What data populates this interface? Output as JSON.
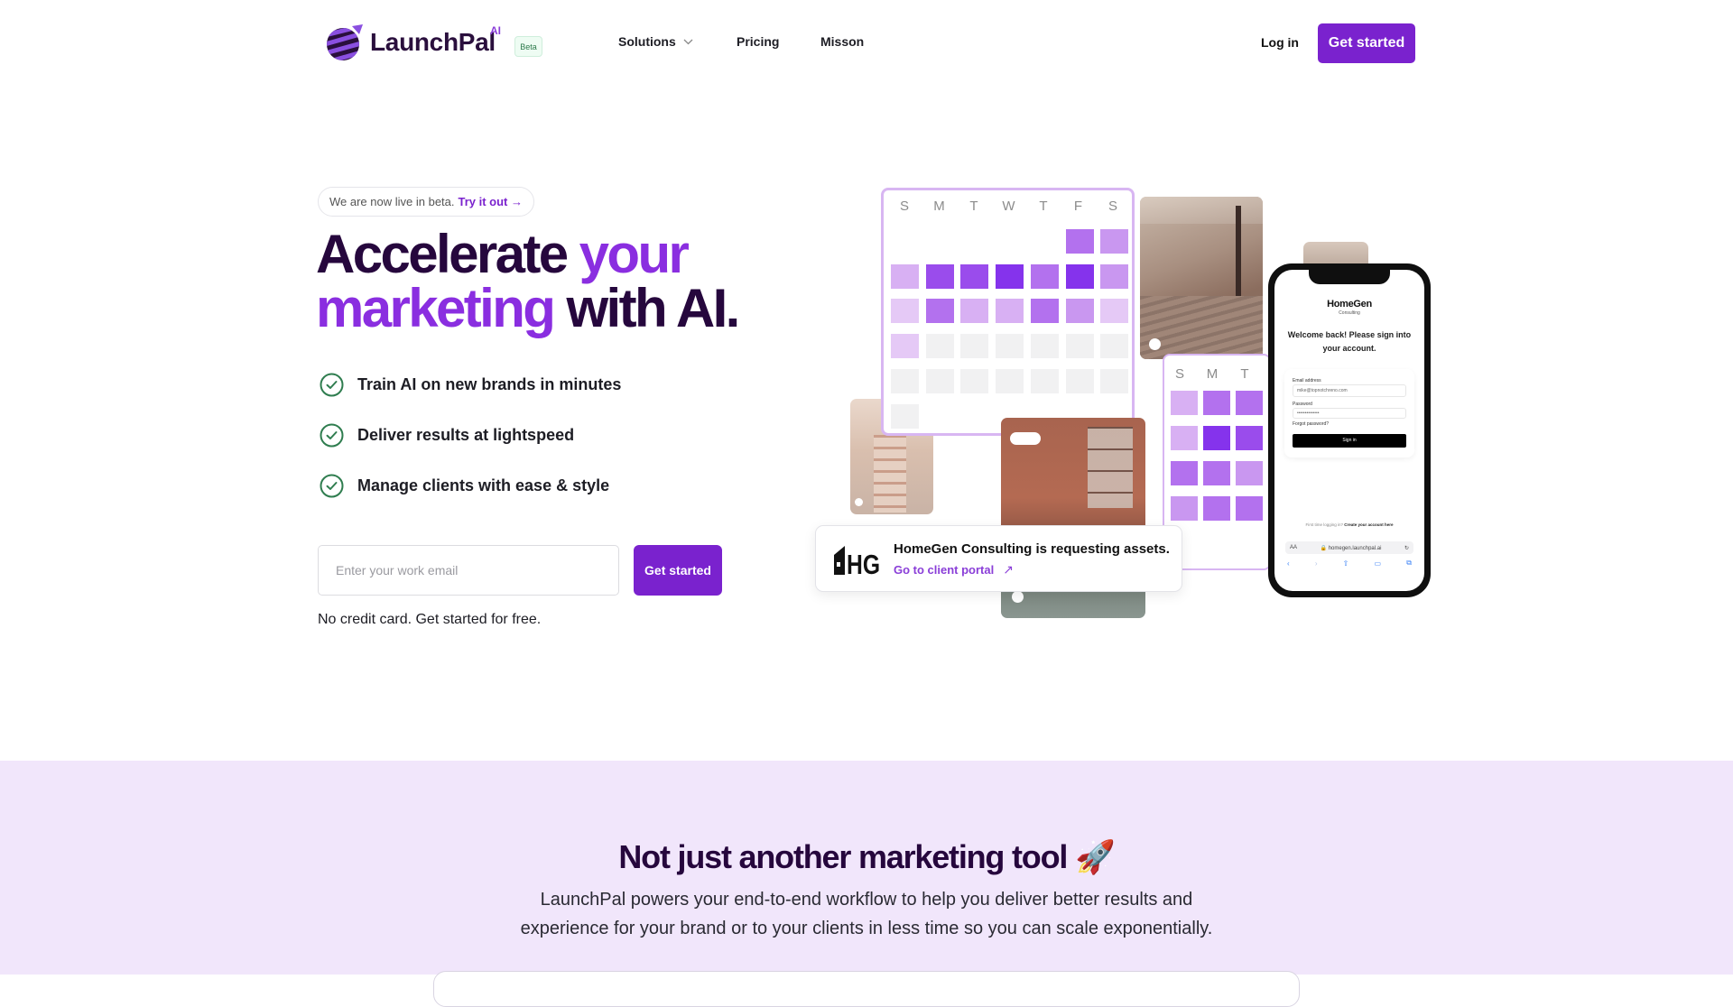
{
  "header": {
    "brand": "LaunchPal",
    "brand_superscript": "AI",
    "beta_badge": "Beta",
    "nav": [
      {
        "label": "Solutions",
        "has_dropdown": true
      },
      {
        "label": "Pricing",
        "has_dropdown": false
      },
      {
        "label": "Misson",
        "has_dropdown": false
      }
    ],
    "login_label": "Log in",
    "cta_label": "Get started"
  },
  "hero": {
    "announcement": "We are now live in beta.",
    "announcement_link": "Try it out →",
    "headline": {
      "line1_dark": "Accelerate",
      "line1_accent": "your",
      "line2_accent": "marketing",
      "line2_dark": "with AI."
    },
    "features": [
      "Train AI on new brands in minutes",
      "Deliver results at lightspeed",
      "Manage clients with ease & style"
    ],
    "email_placeholder": "Enter your work email",
    "email_value": "",
    "cta_label": "Get started",
    "footnote": "No credit card. Get started for free."
  },
  "illustration": {
    "calendar_days": [
      "S",
      "M",
      "T",
      "W",
      "T",
      "F",
      "S"
    ],
    "calendar_small_days": [
      "S",
      "M",
      "T"
    ],
    "notification": {
      "logo_text": "HG",
      "title": "HomeGen Consulting is requesting assets.",
      "link": "Go to client portal",
      "link_icon": "arrow-up-right-icon"
    },
    "phone": {
      "brand": "HomeGen",
      "brand_sub": "Consulting",
      "welcome": "Welcome back! Please sign into your account.",
      "email_label": "Email address",
      "email_value": "mike@topnotchreno.com",
      "password_label": "Password",
      "password_value": "••••••••••••••",
      "forgot": "Forgot password?",
      "signin": "Sign in",
      "create_prefix": "First time logging in?",
      "create_link": "Create your account here",
      "url_aa": "AA",
      "url": "homegen.launchpal.ai"
    }
  },
  "section2": {
    "title": "Not just another marketing tool",
    "title_emoji": "🚀",
    "body": "LaunchPal powers your end-to-end workflow to help you deliver better results and experience for your brand or to your clients in less time so you can scale exponentially."
  },
  "colors": {
    "brand_purple": "#7a22ce",
    "headline_dark": "#26073d",
    "accent_purple": "#8a2ee0",
    "check_green": "#2f7d4f",
    "section_bg": "#f1e6fb"
  }
}
